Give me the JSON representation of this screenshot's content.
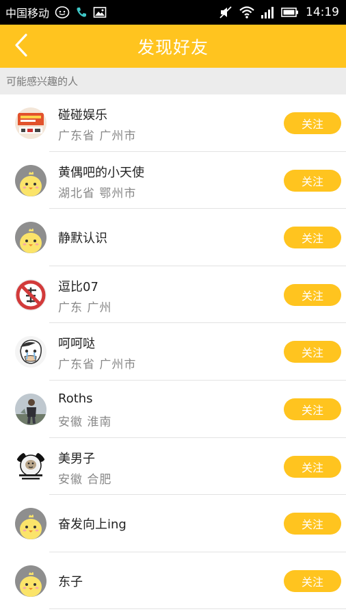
{
  "status_bar": {
    "carrier": "中国移动",
    "time": "14:19"
  },
  "header": {
    "title": "发现好友",
    "back_icon": "chevron-left-icon"
  },
  "section": {
    "label": "可能感兴趣的人"
  },
  "follow_label": "关注",
  "colors": {
    "accent": "#ffc41f",
    "status_bar_bg": "#000000",
    "section_bg": "#ececec"
  },
  "users": [
    {
      "name": "碰碰娱乐",
      "location": "广东省 广州市",
      "avatar": "brand-logo-avatar"
    },
    {
      "name": "黄偶吧的小天使",
      "location": "湖北省 鄂州市",
      "avatar": "default-chick-avatar"
    },
    {
      "name": "静默认识",
      "location": "",
      "avatar": "default-chick-avatar"
    },
    {
      "name": "逗比07",
      "location": "广东 广州",
      "avatar": "no-sign-avatar"
    },
    {
      "name": "呵呵哒",
      "location": "广东省 广州市",
      "avatar": "cartoon-face-avatar"
    },
    {
      "name": "Roths",
      "location": "安徽 淮南",
      "avatar": "photo-person-avatar"
    },
    {
      "name": "美男子",
      "location": "安徽 合肥",
      "avatar": "panda-meme-avatar"
    },
    {
      "name": "奋发向上ing",
      "location": "",
      "avatar": "default-chick-avatar"
    },
    {
      "name": "东子",
      "location": "",
      "avatar": "default-chick-avatar"
    }
  ]
}
